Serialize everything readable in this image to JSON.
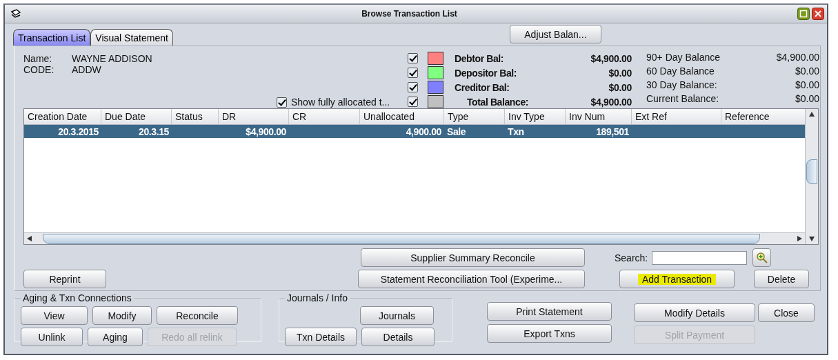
{
  "window": {
    "title": "Browse Transaction List"
  },
  "tabs": [
    {
      "label": "Transaction List",
      "selected": true
    },
    {
      "label": "Visual Statement",
      "selected": false
    }
  ],
  "adjust_button": {
    "label": "Adjust Balan..."
  },
  "customer": [
    {
      "label": "Name:",
      "value": "WAYNE ADDISON"
    },
    {
      "label": "CODE:",
      "value": "ADDW"
    }
  ],
  "show_allocated": {
    "label": "Show fully allocated t...",
    "checked": true
  },
  "balances": [
    {
      "kind": "line",
      "label": "Debtor Bal:",
      "value": "$4,900.00",
      "checked": true,
      "color": "#ff8080"
    },
    {
      "kind": "line",
      "label": "Depositor Bal:",
      "value": "$0.00",
      "checked": true,
      "color": "#80ff80"
    },
    {
      "kind": "line",
      "label": "Creditor Bal:",
      "value": "$0.00",
      "checked": true,
      "color": "#8080ff"
    },
    {
      "kind": "total",
      "label": "Total Balance:",
      "value": "$4,900.00",
      "checked": true,
      "color": "#c0c0c0"
    }
  ],
  "aging": [
    {
      "label": "90+ Day Balance",
      "value": "$4,900.00"
    },
    {
      "label": "60 Day Balance",
      "value": "$0.00"
    },
    {
      "label": "30 Day Balance:",
      "value": "$0.00"
    },
    {
      "label": "Current Balance:",
      "value": "$0.00"
    }
  ],
  "table": {
    "columns": [
      "Creation Date",
      "Due Date",
      "Status",
      "DR",
      "CR",
      "Unallocated",
      "Type",
      "Inv Type",
      "Inv Num",
      "Ext Ref",
      "Reference"
    ],
    "rows": [
      {
        "selected": true,
        "cells": [
          "20.3.2015",
          "20.3.15",
          "",
          "$4,900.00",
          "",
          "4,900.00",
          "Sale",
          "Txn",
          "189,501",
          "",
          ""
        ]
      }
    ]
  },
  "supplier_button": {
    "label": "Supplier Summary Reconcile"
  },
  "search": {
    "label": "Search:"
  },
  "reprint_button": {
    "label": "Reprint"
  },
  "statement_button": {
    "label": "Statement Reconciliation Tool (Experime..."
  },
  "add_button": {
    "label": "Add Transaction",
    "highlighted": true
  },
  "delete_button": {
    "label": "Delete"
  },
  "aging_group": {
    "title": "Aging & Txn Connections",
    "rows": [
      [
        {
          "label": "View",
          "disabled": false
        },
        {
          "label": "Modify",
          "disabled": false
        },
        {
          "label": "Reconcile",
          "disabled": false
        }
      ],
      [
        {
          "label": "Unlink",
          "disabled": false
        },
        {
          "label": "Aging",
          "disabled": false
        },
        {
          "label": "Redo all relink",
          "disabled": true
        }
      ]
    ]
  },
  "journals_group": {
    "title": "Journals / Info",
    "buttons": [
      {
        "label": "Journals",
        "disabled": false
      },
      {
        "label": "Txn Details",
        "disabled": false
      },
      {
        "label": "Details",
        "disabled": false
      }
    ]
  },
  "actions": [
    {
      "label": "Print Statement",
      "disabled": false
    },
    {
      "label": "Export Txns",
      "disabled": false
    }
  ],
  "details_actions": [
    {
      "label": "Modify Details",
      "disabled": false
    },
    {
      "label": "Split Payment",
      "disabled": true
    }
  ],
  "close_button": {
    "label": "Close"
  }
}
